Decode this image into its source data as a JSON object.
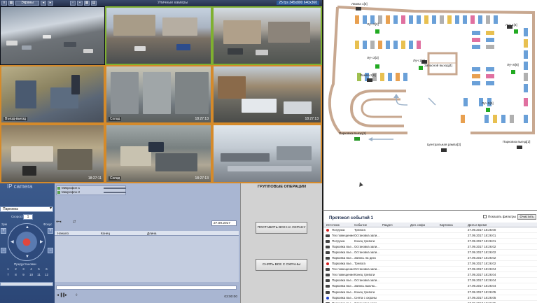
{
  "monitor": {
    "tab_label": "Экраны",
    "title": "Уличные камеры",
    "resolution": "25 fps 345x800 640x360",
    "tiles": [
      {
        "id": "1",
        "label": "",
        "timestamp": ""
      },
      {
        "id": "2",
        "label": "",
        "timestamp": ""
      },
      {
        "id": "3",
        "label": "",
        "timestamp": ""
      },
      {
        "id": "4",
        "label": "Въезд-выезд",
        "timestamp": ""
      },
      {
        "id": "5",
        "label": "Склад",
        "timestamp": "18:27:13"
      },
      {
        "id": "6",
        "label": "",
        "timestamp": "18:27:13"
      },
      {
        "id": "7",
        "label": "",
        "timestamp": "18:27:11"
      },
      {
        "id": "8",
        "label": "Склад",
        "timestamp": "18:27:13"
      },
      {
        "id": "9",
        "label": "",
        "timestamp": ""
      }
    ]
  },
  "map": {
    "labels": {
      "lamp": "Лампа 1[5]",
      "pos2": "Луч 2[2]",
      "pos4": "Луч 4[4]",
      "pos3": "Луч 3[3]",
      "pos1": "Луч 1[1]",
      "lamp2": "Лампа 2[6]",
      "emerg": "Запасной выход[4]",
      "pos6": "Луч 6[6]",
      "pos5": "Луч 5[5]",
      "park_exit": "Парковка въезд[1]",
      "central": "Центральная рампа[3]",
      "park_exit2": "Парковка выезд[2]"
    }
  },
  "ptz": {
    "title": "IP camera",
    "preset_select": "Парковка",
    "speed_label": "Скорость",
    "speed_value": "1",
    "zoom_label": "Зум",
    "focus_label": "Фокус",
    "presets_label": "Предустановки",
    "presets": [
      "1",
      "2",
      "3",
      "4",
      "5",
      "6",
      "7",
      "8",
      "9",
      "10",
      "11",
      "12"
    ]
  },
  "archive": {
    "sources": [
      {
        "name": "Микрофон 1"
      },
      {
        "name": "Микрофон 2"
      }
    ],
    "date": "27.09.2017",
    "columns": [
      "Начало",
      "Конец",
      "Длина"
    ],
    "time": "03:00:00"
  },
  "group_ops": {
    "title": "ГРУППОВЫЕ ОПЕРАЦИИ",
    "arm_all": "ПОСТАВИТЬ ВСЕ НА ОХРАНУ",
    "disarm_all": "СНЯТЬ ВСЕ С ОХРАНЫ"
  },
  "events": {
    "title": "Протокол событий 1",
    "show_filters": "Показать фильтры",
    "clear_button": "Очистить",
    "columns": [
      "Источник",
      "Событие",
      "Раздел",
      "Доп. инфо",
      "Картинка",
      "Дата и время"
    ],
    "rows": [
      {
        "source": "Погрузка",
        "event": "Тревога",
        "time": "27.09.2017 18:26:00",
        "kind": "red"
      },
      {
        "source": "Тех помещение",
        "event": "Остановка запи...",
        "time": "27.09.2017 18:26:01",
        "kind": "cam"
      },
      {
        "source": "Погрузка",
        "event": "Конец тревоги",
        "time": "27.09.2017 18:26:01",
        "kind": "cam"
      },
      {
        "source": "Парковка въе...",
        "event": "Остановка запи...",
        "time": "27.09.2017 18:26:02",
        "kind": "cam"
      },
      {
        "source": "Парковка въе...",
        "event": "Остановка запи...",
        "time": "27.09.2017 18:26:02",
        "kind": "cam"
      },
      {
        "source": "Парковка въе...",
        "event": "Запись на диск",
        "time": "27.09.2017 18:26:02",
        "kind": "cam"
      },
      {
        "source": "Парковка въе...",
        "event": "Тревога",
        "time": "27.09.2017 18:26:02",
        "kind": "red"
      },
      {
        "source": "Тех помещение",
        "event": "Остановка запи...",
        "time": "27.09.2017 18:26:04",
        "kind": "cam"
      },
      {
        "source": "Тех помещение",
        "event": "Конец тревоги",
        "time": "27.09.2017 18:26:04",
        "kind": "cam"
      },
      {
        "source": "Парковка въе...",
        "event": "Остановка запи...",
        "time": "27.09.2017 18:26:04",
        "kind": "cam"
      },
      {
        "source": "Парковка въе...",
        "event": "Запись выклю...",
        "time": "27.09.2017 18:26:04",
        "kind": "cam"
      },
      {
        "source": "Парковка въе...",
        "event": "Конец тревоги",
        "time": "27.09.2017 18:26:05",
        "kind": "cam"
      },
      {
        "source": "Парковка въе...",
        "event": "Снята с охраны",
        "time": "27.09.2017 18:26:05",
        "kind": "blue"
      },
      {
        "source": "Парковка въе...",
        "event": "Остановка запи...",
        "time": "27.09.2017 18:26:05",
        "kind": "cam"
      }
    ]
  },
  "colors": {
    "alarm": "#d42020",
    "armed": "#22aa22",
    "disarmed": "#2244cc"
  }
}
